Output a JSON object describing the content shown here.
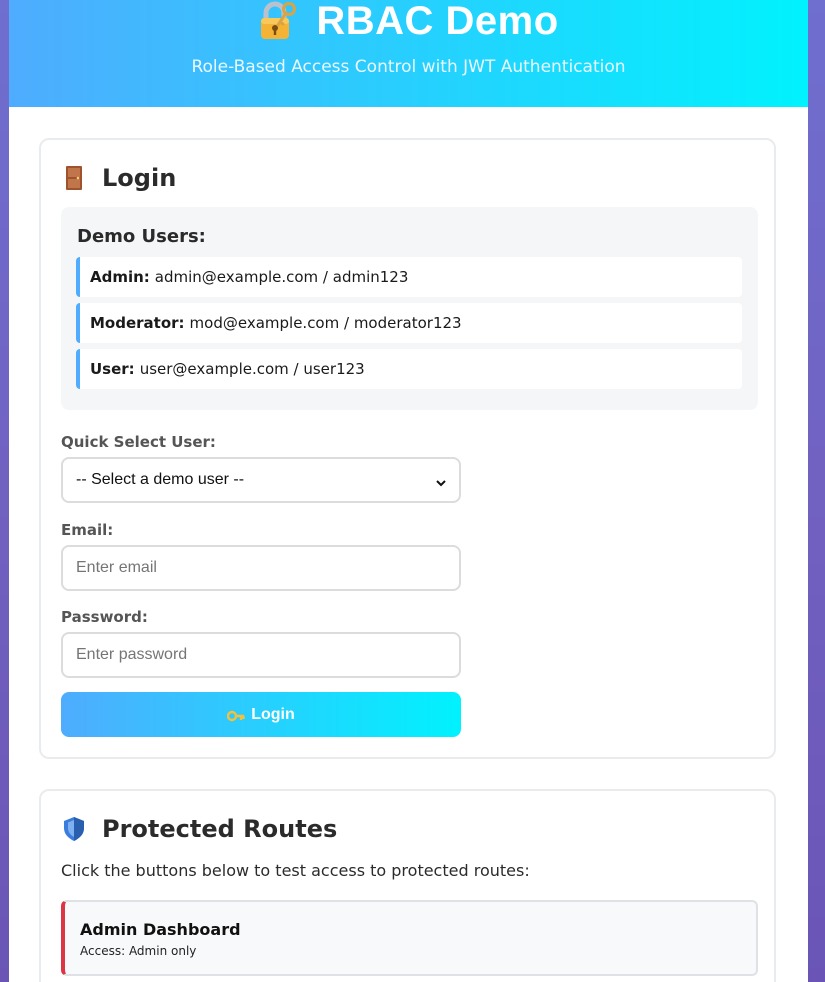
{
  "header": {
    "title": "RBAC Demo",
    "subtitle": "Role-Based Access Control with JWT Authentication",
    "icon": "lock-with-key-icon"
  },
  "login_card": {
    "title": "Login",
    "icon": "door-icon",
    "demo_users": {
      "heading": "Demo Users:",
      "items": [
        {
          "role": "Admin:",
          "credentials": "admin@example.com / admin123"
        },
        {
          "role": "Moderator:",
          "credentials": "mod@example.com / moderator123"
        },
        {
          "role": "User:",
          "credentials": "user@example.com / user123"
        }
      ]
    },
    "quick_select": {
      "label": "Quick Select User:",
      "value": "-- Select a demo user --"
    },
    "email": {
      "label": "Email:",
      "placeholder": "Enter email"
    },
    "password": {
      "label": "Password:",
      "placeholder": "Enter password"
    },
    "login_button": {
      "label": "Login",
      "icon": "key-icon"
    }
  },
  "routes_card": {
    "title": "Protected Routes",
    "icon": "shield-icon",
    "intro": "Click the buttons below to test access to protected routes:",
    "routes": [
      {
        "name": "Admin Dashboard",
        "access": "Access: Admin only",
        "accent": "#dc3545"
      }
    ]
  },
  "colors": {
    "gradient_start": "#4facfe",
    "gradient_end": "#00f2fe",
    "page_background": "#7160c0"
  }
}
